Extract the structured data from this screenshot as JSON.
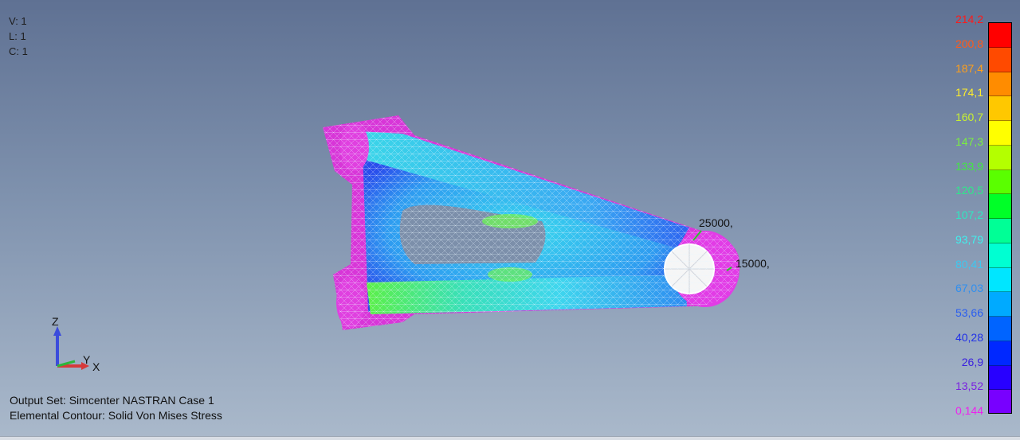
{
  "view_info": {
    "view": "V: 1",
    "layer": "L: 1",
    "color": "C: 1"
  },
  "output_set": "Output Set: Simcenter NASTRAN Case 1",
  "contour": "Elemental Contour: Solid Von Mises Stress",
  "loads": {
    "load_1": "25000,",
    "load_2": "15000,"
  },
  "axes": {
    "z": "Z",
    "y": "Y",
    "x": "X"
  },
  "legend": {
    "labels": [
      "214,2",
      "200,8",
      "187,4",
      "174,1",
      "160,7",
      "147,3",
      "133,9",
      "120,5",
      "107,2",
      "93,79",
      "80,41",
      "67,03",
      "53,66",
      "40,28",
      "26,9",
      "13,52",
      "0,144"
    ],
    "label_colors": [
      "#ff1a1a",
      "#ff5a1a",
      "#ff9f1a",
      "#ffee2a",
      "#c8f030",
      "#7af040",
      "#40e840",
      "#2ee88a",
      "#2ee8c0",
      "#3ff0ee",
      "#3cc8f0",
      "#2e8ff0",
      "#2a5ef0",
      "#2030e8",
      "#3a20e0",
      "#7a20e0",
      "#ee20ee"
    ],
    "bar_colors": [
      "#ff0000",
      "#ff4a00",
      "#ff8c00",
      "#ffc800",
      "#ffff00",
      "#b4ff00",
      "#5aff00",
      "#00ff28",
      "#00ff96",
      "#00ffd2",
      "#00e6ff",
      "#00aaff",
      "#0064ff",
      "#0028ff",
      "#2800ff",
      "#7800ff"
    ]
  }
}
